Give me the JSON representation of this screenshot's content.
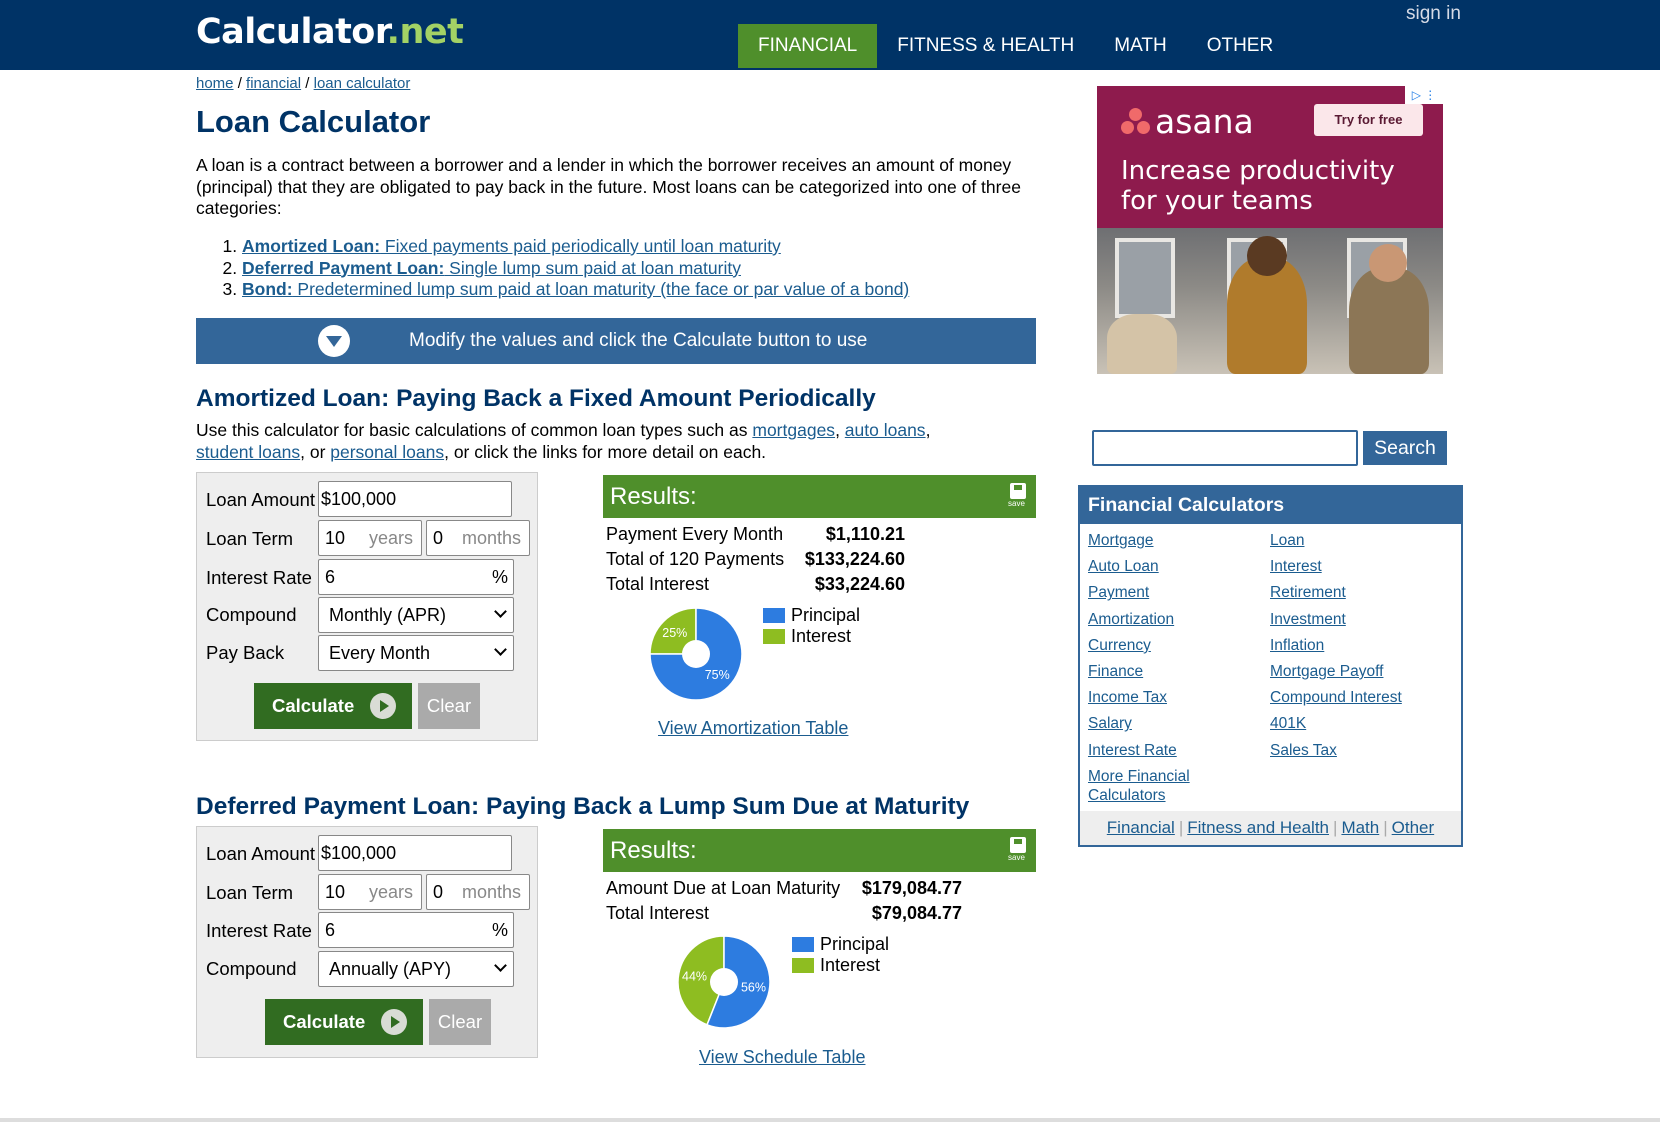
{
  "header": {
    "logo_main": "Calculator",
    "logo_dot": ".",
    "logo_net": "net",
    "nav": [
      "FINANCIAL",
      "FITNESS & HEALTH",
      "MATH",
      "OTHER"
    ],
    "signin": "sign in"
  },
  "breadcrumb": {
    "home": "home",
    "sep": " / ",
    "financial": "financial",
    "current": "loan calculator"
  },
  "title": "Loan Calculator",
  "intro": "A loan is a contract between a borrower and a lender in which the borrower receives an amount of money (principal) that they are obligated to pay back in the future. Most loans can be categorized into one of three categories:",
  "types": [
    {
      "bold": "Amortized Loan:",
      "rest": " Fixed payments paid periodically until loan maturity"
    },
    {
      "bold": "Deferred Payment Loan:",
      "rest": " Single lump sum paid at loan maturity"
    },
    {
      "bold": "Bond:",
      "rest": " Predetermined lump sum paid at loan maturity (the face or par value of a bond)"
    }
  ],
  "modify_bar": "Modify the values and click the Calculate button to use",
  "amortized": {
    "title": "Amortized Loan: Paying Back a Fixed Amount Periodically",
    "desc_pre": "Use this calculator for basic calculations of common loan types such as ",
    "links": [
      "mortgages",
      "auto loans",
      "student loans",
      "personal loans"
    ],
    "desc_sep1": ", ",
    "desc_sep2": ",",
    "desc_sep3": ", or ",
    "desc_post": ", or click the links for more detail on each.",
    "form": {
      "loan_amount_label": "Loan Amount",
      "loan_amount": "$100,000",
      "loan_term_label": "Loan Term",
      "years": "10",
      "years_unit": "years",
      "months": "0",
      "months_unit": "months",
      "rate_label": "Interest Rate",
      "rate": "6",
      "pct": "%",
      "compound_label": "Compound",
      "compound": "Monthly (APR)",
      "payback_label": "Pay Back",
      "payback": "Every Month",
      "calculate": "Calculate",
      "clear": "Clear"
    },
    "results": {
      "title": "Results:",
      "save": "save",
      "rows": [
        {
          "label": "Payment Every Month",
          "value": "$1,110.21"
        },
        {
          "label": "Total of 120 Payments",
          "value": "$133,224.60"
        },
        {
          "label": "Total Interest",
          "value": "$33,224.60"
        }
      ],
      "legend": [
        "Principal",
        "Interest"
      ],
      "pie": {
        "principal_pct": 75,
        "interest_pct": 25,
        "principal_label": "75%",
        "interest_label": "25%"
      },
      "link": "View Amortization Table"
    }
  },
  "deferred": {
    "title": "Deferred Payment Loan: Paying Back a Lump Sum Due at Maturity",
    "form": {
      "loan_amount_label": "Loan Amount",
      "loan_amount": "$100,000",
      "loan_term_label": "Loan Term",
      "years": "10",
      "years_unit": "years",
      "months": "0",
      "months_unit": "months",
      "rate_label": "Interest Rate",
      "rate": "6",
      "pct": "%",
      "compound_label": "Compound",
      "compound": "Annually (APY)",
      "calculate": "Calculate",
      "clear": "Clear"
    },
    "results": {
      "title": "Results:",
      "save": "save",
      "rows": [
        {
          "label": "Amount Due at Loan Maturity",
          "value": "$179,084.77"
        },
        {
          "label": "Total Interest",
          "value": "$79,084.77"
        }
      ],
      "legend": [
        "Principal",
        "Interest"
      ],
      "pie": {
        "principal_pct": 56,
        "interest_pct": 44,
        "principal_label": "56%",
        "interest_label": "44%"
      },
      "link": "View Schedule Table"
    }
  },
  "ad": {
    "brand": "asana",
    "cta": "Try for free",
    "headline_1": "Increase productivity",
    "headline_2": "for your teams",
    "adchoice": "▷ ⋮"
  },
  "search": {
    "placeholder": "",
    "button": "Search"
  },
  "financial_calculators": {
    "title": "Financial Calculators",
    "left": [
      "Mortgage",
      "Auto Loan",
      "Payment",
      "Amortization",
      "Currency",
      "Finance",
      "Income Tax",
      "Salary",
      "Interest Rate",
      "More Financial",
      "Calculators"
    ],
    "right": [
      "Loan",
      "Interest",
      "Retirement",
      "Investment",
      "Inflation",
      "Mortgage Payoff",
      "Compound Interest",
      "401K",
      "Sales Tax"
    ],
    "footer": [
      "Financial",
      "Fitness and Health",
      "Math",
      "Other"
    ],
    "footer_sep": "|"
  },
  "colors": {
    "navy": "#003366",
    "accent_blue": "#336699",
    "green": "#4f8f2b",
    "pie_principal": "#2d7ce0",
    "pie_interest": "#8ebd21"
  }
}
